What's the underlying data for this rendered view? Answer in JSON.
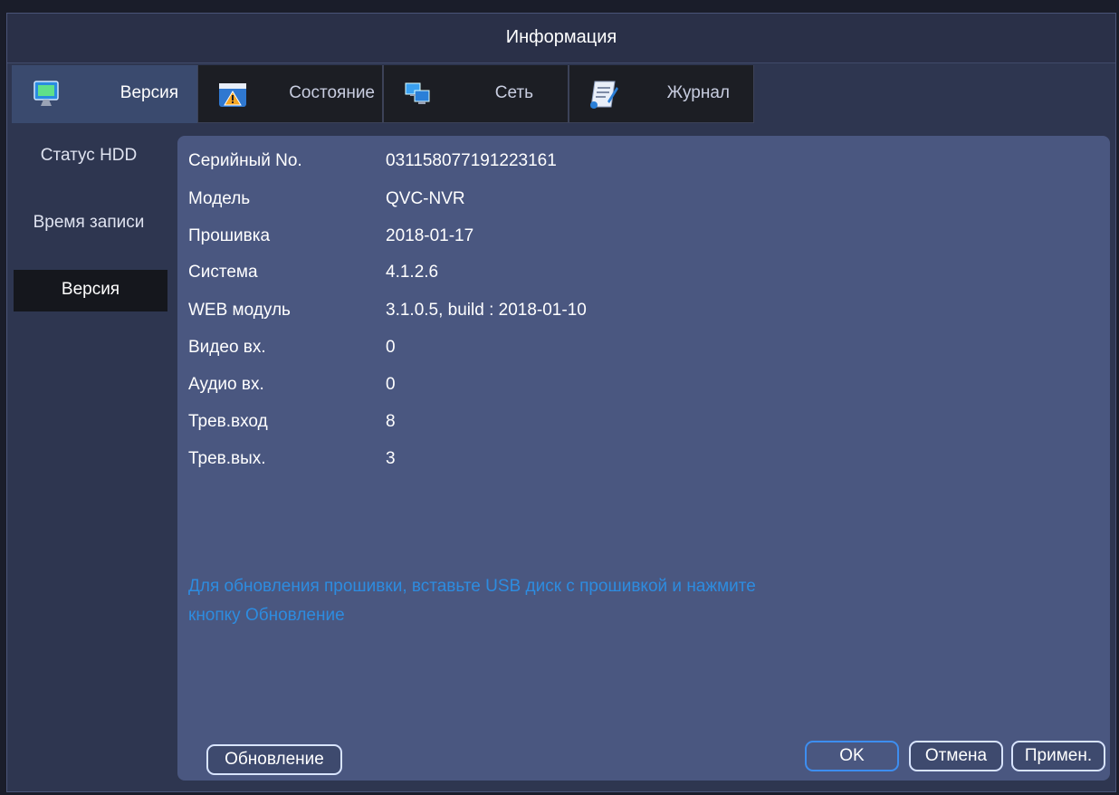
{
  "window": {
    "title": "Информация"
  },
  "tabs": [
    {
      "label": "Версия",
      "icon": "monitor-icon",
      "active": true
    },
    {
      "label": "Состояние",
      "icon": "warning-icon",
      "active": false
    },
    {
      "label": "Сеть",
      "icon": "network-icon",
      "active": false
    },
    {
      "label": "Журнал",
      "icon": "log-icon",
      "active": false
    }
  ],
  "sidebar": {
    "items": [
      {
        "label": "Статус HDD",
        "active": false
      },
      {
        "label": "Время записи",
        "active": false
      },
      {
        "label": "Версия",
        "active": true
      }
    ]
  },
  "info": {
    "rows": [
      {
        "key": "Серийный No.",
        "value": "031158077191223161"
      },
      {
        "key": "Модель",
        "value": "QVC-NVR"
      },
      {
        "key": "Прошивка",
        "value": "2018-01-17"
      },
      {
        "key": "Система",
        "value": "4.1.2.6"
      },
      {
        "key": "WEB модуль",
        "value": "3.1.0.5, build : 2018-01-10"
      },
      {
        "key": "Видео вх.",
        "value": "0"
      },
      {
        "key": "Аудио вх.",
        "value": "0"
      },
      {
        "key": "Трев.вход",
        "value": "8"
      },
      {
        "key": "Трев.вых.",
        "value": "3"
      }
    ],
    "notice_line1": "Для обновления прошивки, вставьте USB диск с прошивкой и нажмите",
    "notice_line2": "кнопку Обновление"
  },
  "buttons": {
    "update": "Обновление",
    "ok": "OK",
    "cancel": "Отмена",
    "apply": "Примен."
  },
  "colors": {
    "panel": "#4a5780",
    "notice": "#2d8ce0",
    "active_tab": "#3a4a6e",
    "ok_border": "#3d8ef0"
  }
}
